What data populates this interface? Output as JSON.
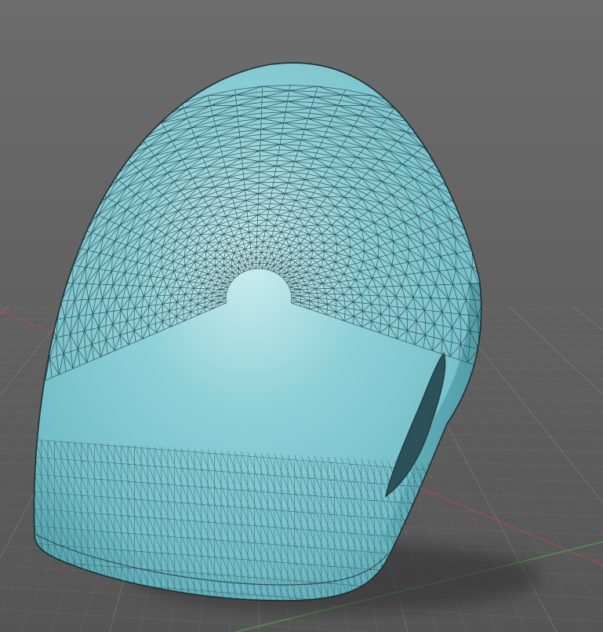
{
  "viewport": {
    "title": "",
    "model_name": "",
    "colors": {
      "background_top": "#6b6b6b",
      "background_bottom": "#555555",
      "grid_major": "#8a8a8a",
      "grid_minor": "#7a7a7a",
      "axis_x": "#b84a4a",
      "axis_y": "#4fae4f",
      "mesh_fill": "#7cc5cf",
      "mesh_highlight": "#c9ecef",
      "mesh_shade": "#4c9ba6",
      "wireframe": "#1f3b40",
      "shadow": "#2e2e2e"
    },
    "icons": {
      "mesh": "wireframe-mesh-icon",
      "grid": "ground-grid-icon"
    }
  }
}
